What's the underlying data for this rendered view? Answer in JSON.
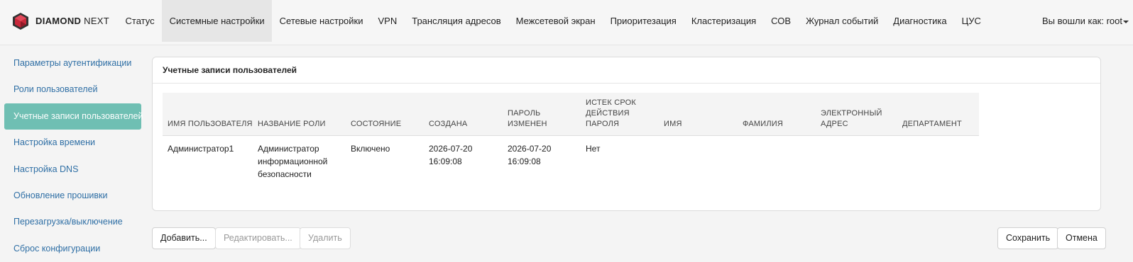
{
  "app": {
    "brand_bold": "DIAMOND",
    "brand_light": "NEXT",
    "logo_icon": "diamond-logo-icon",
    "brand_colors": {
      "logo_primary": "#c8283a",
      "logo_dark": "#333333"
    }
  },
  "nav": {
    "items": [
      {
        "label": "Статус",
        "active": false
      },
      {
        "label": "Системные настройки",
        "active": true
      },
      {
        "label": "Сетевые настройки",
        "active": false
      },
      {
        "label": "VPN",
        "active": false
      },
      {
        "label": "Трансляция адресов",
        "active": false
      },
      {
        "label": "Межсетевой экран",
        "active": false
      },
      {
        "label": "Приоритезация",
        "active": false
      },
      {
        "label": "Кластеризация",
        "active": false
      },
      {
        "label": "СОВ",
        "active": false
      },
      {
        "label": "Журнал событий",
        "active": false
      },
      {
        "label": "Диагностика",
        "active": false
      },
      {
        "label": "ЦУС",
        "active": false
      }
    ],
    "user_menu": "Вы вошли как: root"
  },
  "sidebar": {
    "items": [
      {
        "label": "Параметры аутентификации",
        "active": false
      },
      {
        "label": "Роли пользователей",
        "active": false
      },
      {
        "label": "Учетные записи пользователей",
        "active": true
      },
      {
        "label": "Настройка времени",
        "active": false
      },
      {
        "label": "Настройка DNS",
        "active": false
      },
      {
        "label": "Обновление прошивки",
        "active": false
      },
      {
        "label": "Перезагрузка/выключение",
        "active": false
      },
      {
        "label": "Сброс конфигурации",
        "active": false
      }
    ],
    "active_color": "#6fbfb3",
    "link_color": "#2f6fa5"
  },
  "panel": {
    "title": "Учетные записи пользователей",
    "table": {
      "columns": [
        "Имя пользователя",
        "Название роли",
        "Состояние",
        "Создана",
        "Пароль изменен",
        "Истек срок действия пароля",
        "Имя",
        "Фамилия",
        "Электронный адрес",
        "Департамент"
      ],
      "rows": [
        [
          "Администратор1",
          "Администратор информационной безопасности",
          "Включено",
          "2026-07-20 16:09:08",
          "2026-07-20 16:09:08",
          "Нет",
          "",
          "",
          "",
          ""
        ]
      ]
    }
  },
  "actions": {
    "add": "Добавить...",
    "edit": "Редактировать...",
    "delete": "Удалить",
    "save": "Сохранить",
    "cancel": "Отмена"
  }
}
